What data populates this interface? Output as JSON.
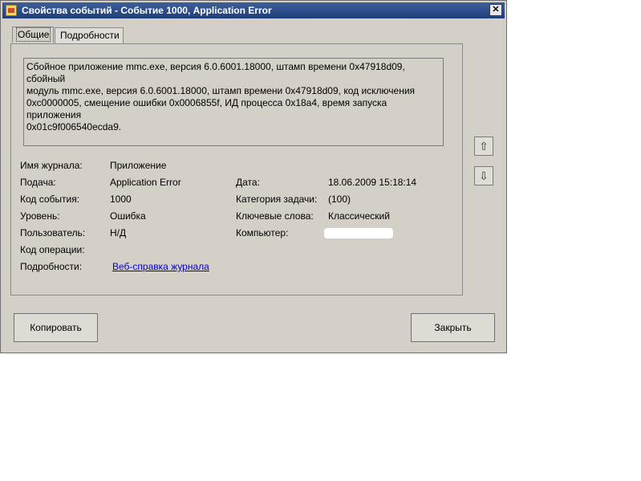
{
  "window": {
    "title": "Свойства событий - Событие 1000, Application Error"
  },
  "tabs": [
    {
      "label": "Общие"
    },
    {
      "label": "Подробности"
    }
  ],
  "description": "Сбойное приложение mmc.exe, версия 6.0.6001.18000, штамп времени 0x47918d09, сбойный\nмодуль mmc.exe, версия 6.0.6001.18000, штамп времени 0x47918d09, код исключения\n0xc0000005, смещение ошибки 0x0006855f, ИД процесса 0x18a4, время запуска приложения\n0x01c9f006540ecda9.",
  "fields": {
    "log_name": {
      "label": "Имя журнала:",
      "value": "Приложение"
    },
    "source": {
      "label": "Подача:",
      "value": "Application Error"
    },
    "date": {
      "label": "Дата:",
      "value": "18.06.2009 15:18:14"
    },
    "event_id": {
      "label": "Код события:",
      "value": "1000"
    },
    "task_category": {
      "label": "Категория задачи:",
      "value": "(100)"
    },
    "level": {
      "label": "Уровень:",
      "value": "Ошибка"
    },
    "keywords": {
      "label": "Ключевые слова:",
      "value": "Классический"
    },
    "user": {
      "label": "Пользователь:",
      "value": "Н/Д"
    },
    "computer": {
      "label": "Компьютер:",
      "value": ""
    },
    "opcode": {
      "label": "Код операции:",
      "value": ""
    },
    "more_info": {
      "label": "Подробности:",
      "link": "Веб-справка журнала"
    }
  },
  "buttons": {
    "copy": "Копировать",
    "close": "Закрыть"
  },
  "icons": {
    "nav_up": "arrow-up-icon",
    "nav_down": "arrow-down-icon",
    "close": "close-icon",
    "app": "event-viewer-icon"
  }
}
